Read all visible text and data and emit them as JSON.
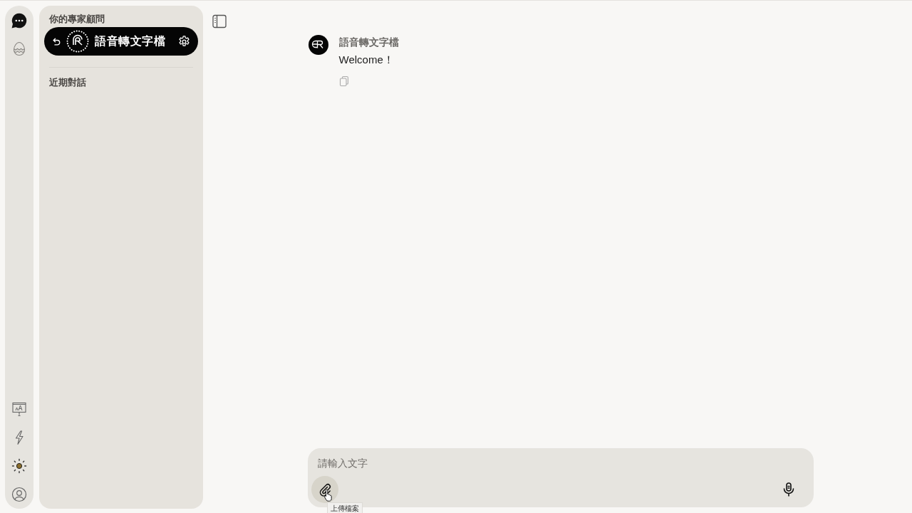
{
  "rail": {
    "items": [
      {
        "selected": true
      },
      {
        "selected": false
      }
    ]
  },
  "sidebar": {
    "title": "你的專家顧問",
    "agent": {
      "name": "語音轉文字檔"
    },
    "section_title": "近期對話"
  },
  "chat": {
    "messages": [
      {
        "sender": "語音轉文字檔",
        "text": "Welcome！"
      }
    ]
  },
  "composer": {
    "placeholder": "請輸入文字",
    "tooltip": "上傳檔案"
  }
}
